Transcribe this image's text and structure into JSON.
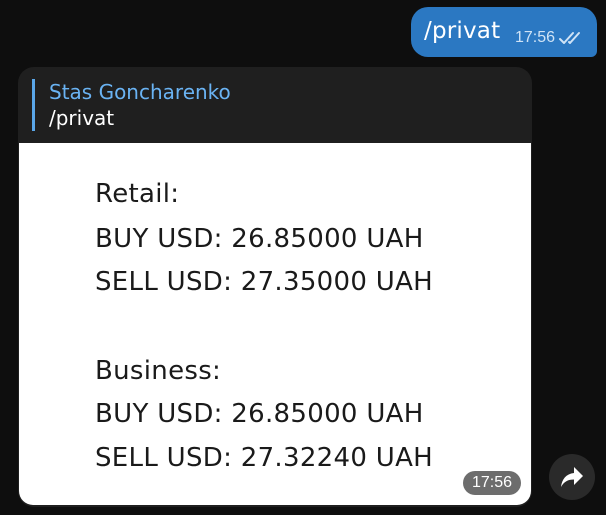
{
  "outgoing": {
    "text": "/privat",
    "time": "17:56",
    "status_icon": "double-check-icon"
  },
  "incoming": {
    "reply_author": "Stas Goncharenko",
    "reply_text": "/privat",
    "photo": {
      "retail_header": "Retail:",
      "retail_buy": "BUY USD: 26.85000 UAH",
      "retail_sell": "SELL USD: 27.35000 UAH",
      "business_header": "Business:",
      "business_buy": "BUY USD: 26.85000 UAH",
      "business_sell": "SELL USD: 27.32240 UAH"
    },
    "time": "17:56"
  },
  "forward_icon": "share-arrow-icon",
  "colors": {
    "background": "#0e0e0e",
    "outgoing_bubble": "#2b78c2",
    "incoming_bubble": "#1f1f1f",
    "reply_accent": "#6ab3f3"
  }
}
